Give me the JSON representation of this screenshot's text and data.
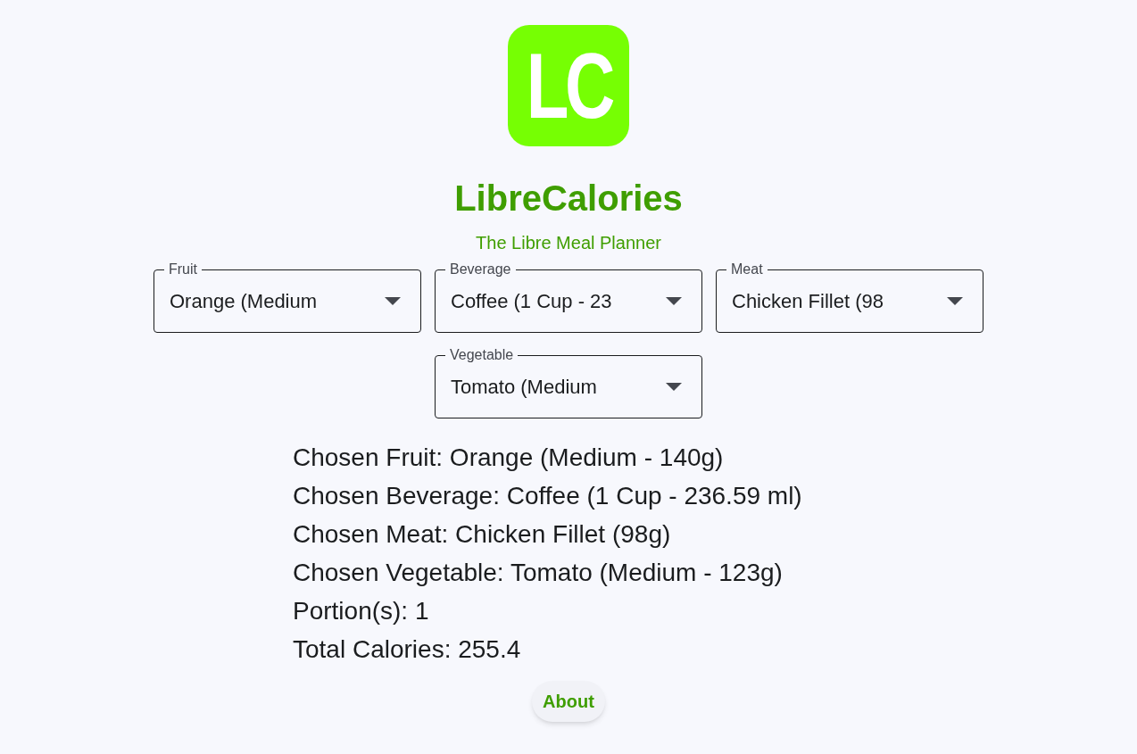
{
  "logo": {
    "text": "LC"
  },
  "title": "LibreCalories",
  "subtitle": "The Libre Meal Planner",
  "dropdowns": [
    {
      "label": "Fruit",
      "value": "Orange (Medium"
    },
    {
      "label": "Beverage",
      "value": "Coffee (1 Cup - 23"
    },
    {
      "label": "Meat",
      "value": "Chicken Fillet (98"
    },
    {
      "label": "Vegetable",
      "value": "Tomato (Medium"
    }
  ],
  "summary": [
    "Chosen Fruit: Orange (Medium - 140g)",
    "Chosen Beverage: Coffee (1 Cup - 236.59 ml)",
    "Chosen Meat: Chicken Fillet (98g)",
    "Chosen Vegetable: Tomato (Medium - 123g)",
    "Portion(s): 1",
    "Total Calories: 255.4"
  ],
  "about_button": "About"
}
